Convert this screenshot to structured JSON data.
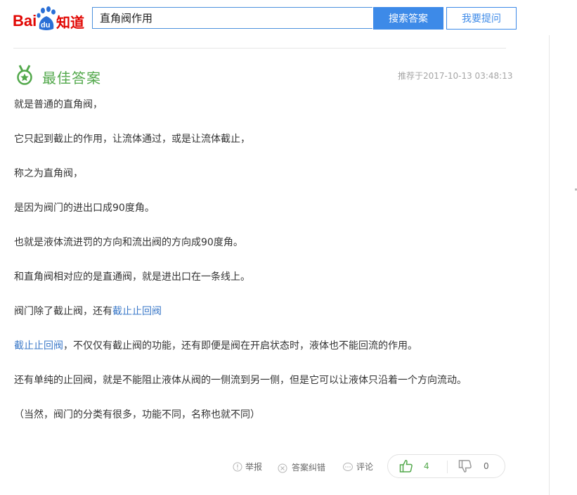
{
  "header": {
    "logo_left": "Bai",
    "logo_du": "du",
    "logo_right": "知道",
    "search_value": "直角阀作用",
    "search_button": "搜索答案",
    "ask_button": "我要提问"
  },
  "answer": {
    "title": "最佳答案",
    "recommended_at": "推荐于2017-10-13 03:48:13",
    "paragraphs": {
      "p1": "就是普通的直角阀，",
      "p2": "它只起到截止的作用，让流体通过，或是让流体截止，",
      "p3": "称之为直角阀，",
      "p4": "是因为阀门的进出口成90度角。",
      "p5": "也就是液体流进罚的方向和流出阀的方向成90度角。",
      "p6": "和直角阀相对应的是直通阀，就是进出口在一条线上。",
      "p7_text": "阀门除了截止阀，还有",
      "p7_link": "截止止回阀",
      "p8_link": "截止止回阀",
      "p8_text": "，不仅仅有截止阀的功能，还有即便是阀在开启状态时，液体也不能回流的作用。",
      "p9": "还有单纯的止回阀，就是不能阻止液体从阀的一侧流到另一侧，但是它可以让液体只沿着一个方向流动。",
      "p10": "（当然，阀门的分类有很多，功能不同，名称也就不同）"
    }
  },
  "actions": {
    "report": "举报",
    "correct": "答案纠错",
    "comment": "评论",
    "up_count": "4",
    "down_count": "0"
  },
  "colors": {
    "brand_red": "#e10602",
    "brand_blue": "#3d8ae8",
    "best_green": "#52a84b",
    "link_blue": "#3a78c8"
  }
}
